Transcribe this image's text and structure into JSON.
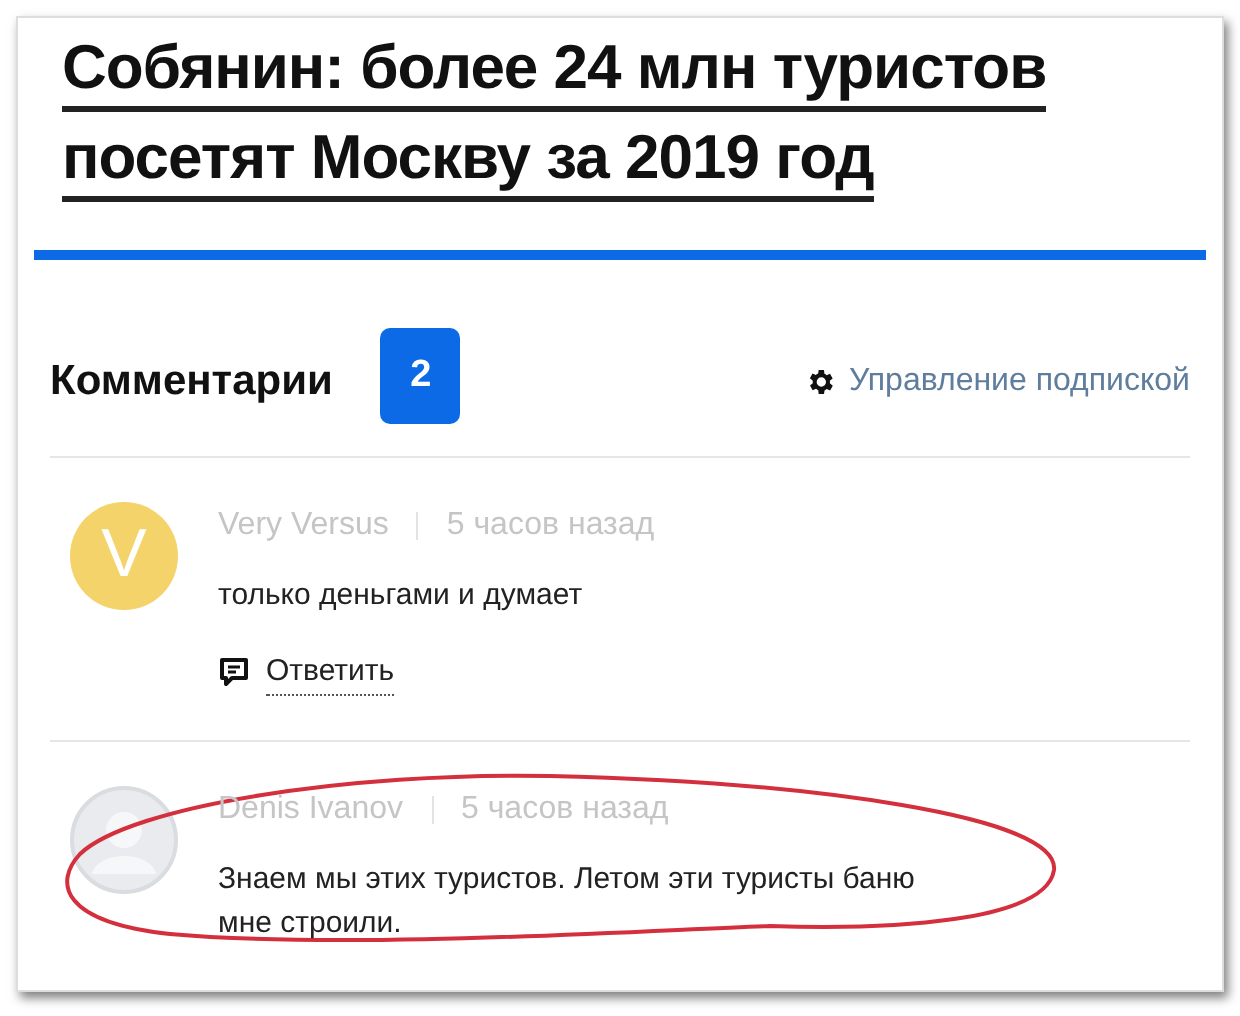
{
  "article": {
    "title_lines": [
      "Собянин: более 24 млн туристов",
      "посетят Москву за 2019 год"
    ]
  },
  "comments_header": {
    "title": "Комментарии",
    "count": "2",
    "subscription_link": "Управление подпиской"
  },
  "comments": [
    {
      "avatar": {
        "kind": "letter",
        "text": "V",
        "color": "#f4d46a"
      },
      "author": "Very Versus",
      "time": "5 часов назад",
      "text": "только деньгами и думает",
      "reply": "Ответить",
      "highlighted": false
    },
    {
      "avatar": {
        "kind": "silhouette"
      },
      "author": "Denis Ivanov",
      "time": "5 часов назад",
      "text": "Знаем мы этих туристов. Летом эти туристы баню мне строили.",
      "highlighted": true
    }
  ]
}
